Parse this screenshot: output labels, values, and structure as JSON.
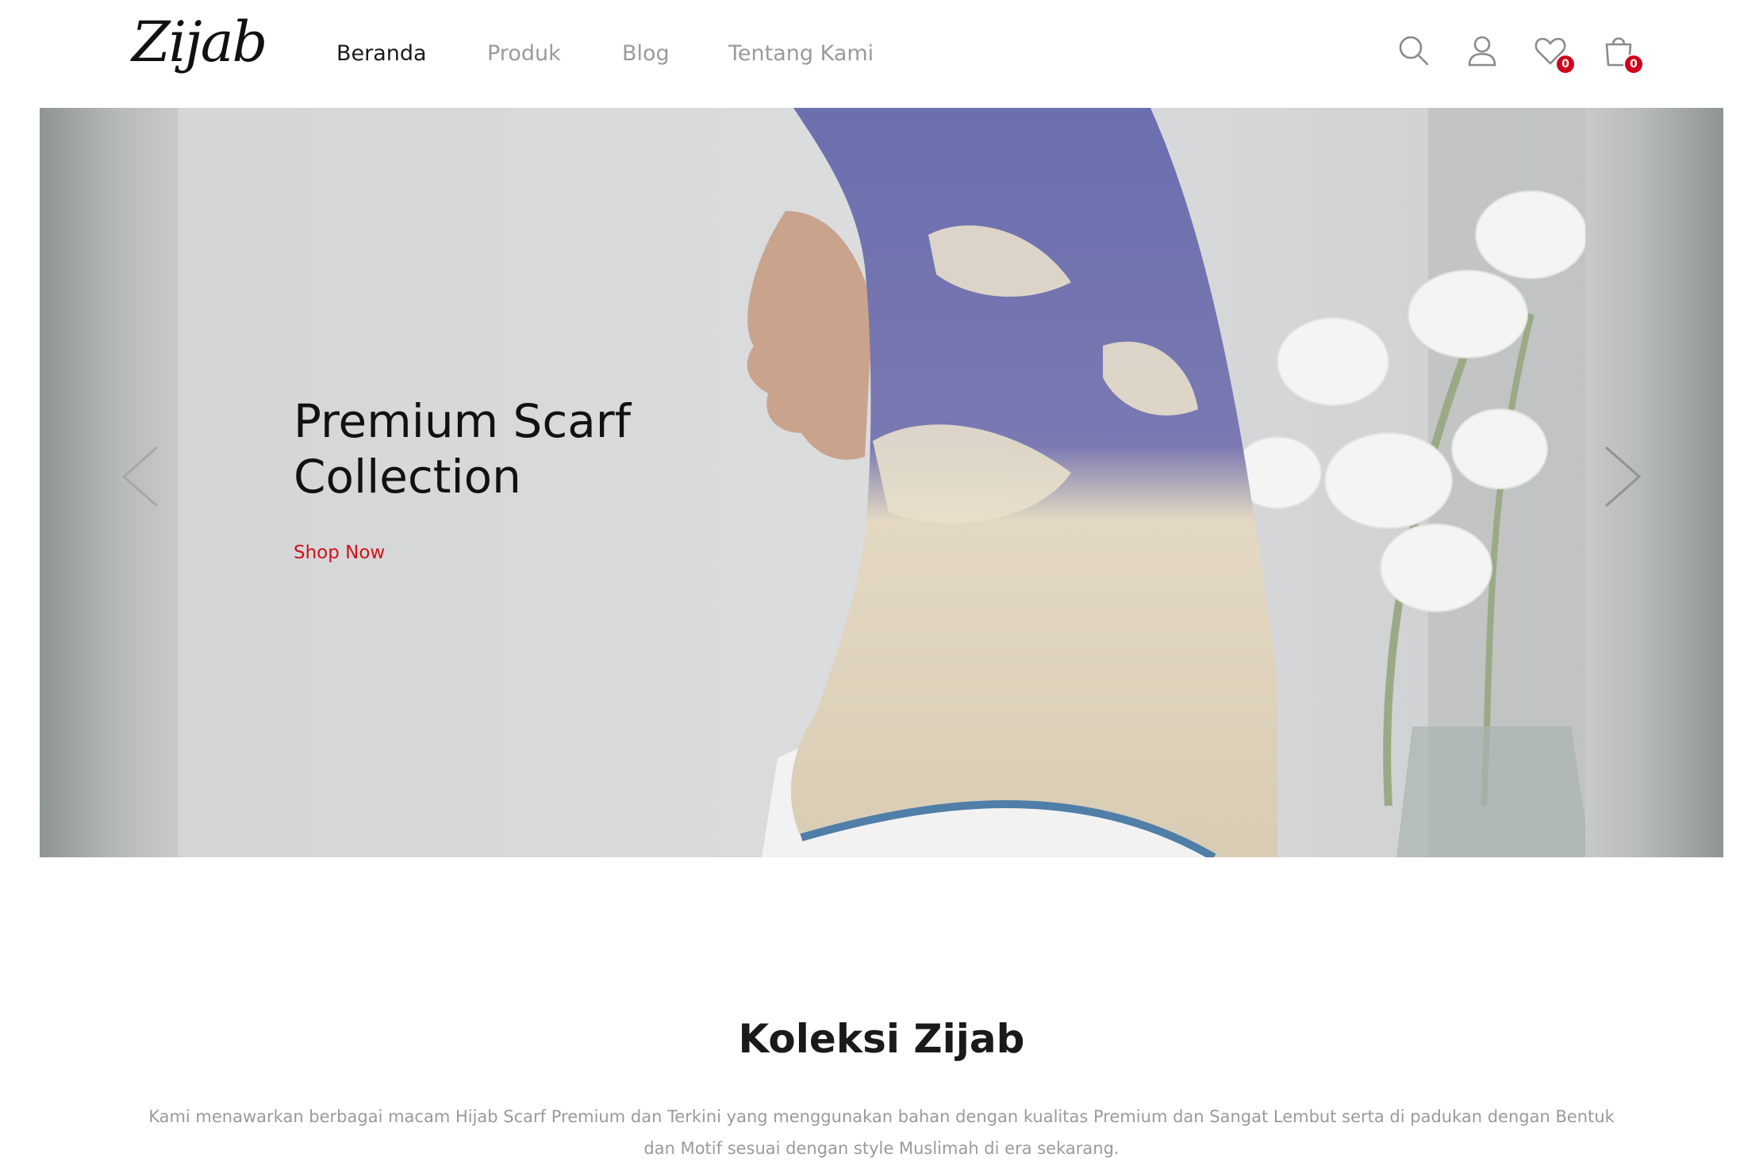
{
  "header": {
    "logo": "Zijab",
    "nav": [
      {
        "label": "Beranda",
        "active": true
      },
      {
        "label": "Produk",
        "active": false
      },
      {
        "label": "Blog",
        "active": false
      },
      {
        "label": "Tentang Kami",
        "active": false
      }
    ],
    "icons": {
      "search": "search-icon",
      "account": "user-icon",
      "wishlist": "heart-icon",
      "cart": "shopping-bag-icon"
    },
    "wishlist_count": "0",
    "cart_count": "0",
    "badge_color": "#d0021b"
  },
  "hero": {
    "title_line1": "Premium Scarf",
    "title_line2": "Collection",
    "cta_label": "Shop Now",
    "cta_color": "#d0121b",
    "prev_icon": "chevron-left-icon",
    "next_icon": "chevron-right-icon"
  },
  "collection": {
    "title": "Koleksi Zijab",
    "description": "Kami menawarkan berbagai macam Hijab Scarf Premium dan Terkini yang menggunakan bahan dengan kualitas Premium dan Sangat Lembut serta di padukan dengan Bentuk dan Motif sesuai dengan style Muslimah di era sekarang."
  }
}
